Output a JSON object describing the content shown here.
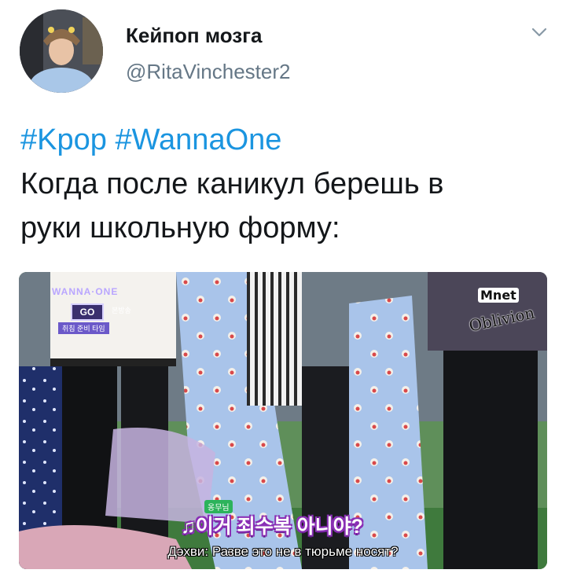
{
  "author": {
    "name": "Кейпоп мозга",
    "handle": "@RitaVinchester2"
  },
  "tweet": {
    "hashtags": [
      "#Kpop",
      "#WannaOne"
    ],
    "lines": [
      "Когда после каникул берешь в",
      "руки школьную форму:"
    ]
  },
  "media": {
    "show_title": "WANNA·ONE",
    "show_go": "GO",
    "show_badge": "본방송",
    "show_sub": "취침 준비 타임",
    "watermark_logo": "Mnet",
    "watermark_text": "Oblivion",
    "caption_tag": "옹무님",
    "caption_korean": "♫이거 죄수복 아니야?",
    "caption_russian": "Дэхви: Разве это не в тюрьме носят?"
  },
  "icons": {
    "menu": "chevron-down-icon"
  },
  "colors": {
    "link": "#1b95e0",
    "handle": "#657786",
    "text": "#14171a"
  }
}
